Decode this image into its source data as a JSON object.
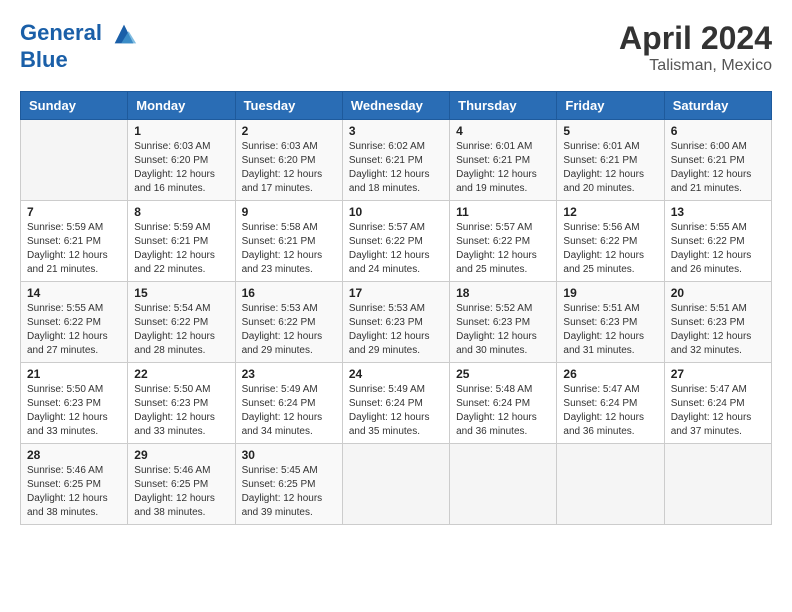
{
  "header": {
    "logo_line1": "General",
    "logo_line2": "Blue",
    "month_year": "April 2024",
    "location": "Talisman, Mexico"
  },
  "weekdays": [
    "Sunday",
    "Monday",
    "Tuesday",
    "Wednesday",
    "Thursday",
    "Friday",
    "Saturday"
  ],
  "weeks": [
    [
      {
        "day": "",
        "sunrise": "",
        "sunset": "",
        "daylight": ""
      },
      {
        "day": "1",
        "sunrise": "Sunrise: 6:03 AM",
        "sunset": "Sunset: 6:20 PM",
        "daylight": "Daylight: 12 hours and 16 minutes."
      },
      {
        "day": "2",
        "sunrise": "Sunrise: 6:03 AM",
        "sunset": "Sunset: 6:20 PM",
        "daylight": "Daylight: 12 hours and 17 minutes."
      },
      {
        "day": "3",
        "sunrise": "Sunrise: 6:02 AM",
        "sunset": "Sunset: 6:21 PM",
        "daylight": "Daylight: 12 hours and 18 minutes."
      },
      {
        "day": "4",
        "sunrise": "Sunrise: 6:01 AM",
        "sunset": "Sunset: 6:21 PM",
        "daylight": "Daylight: 12 hours and 19 minutes."
      },
      {
        "day": "5",
        "sunrise": "Sunrise: 6:01 AM",
        "sunset": "Sunset: 6:21 PM",
        "daylight": "Daylight: 12 hours and 20 minutes."
      },
      {
        "day": "6",
        "sunrise": "Sunrise: 6:00 AM",
        "sunset": "Sunset: 6:21 PM",
        "daylight": "Daylight: 12 hours and 21 minutes."
      }
    ],
    [
      {
        "day": "7",
        "sunrise": "Sunrise: 5:59 AM",
        "sunset": "Sunset: 6:21 PM",
        "daylight": "Daylight: 12 hours and 21 minutes."
      },
      {
        "day": "8",
        "sunrise": "Sunrise: 5:59 AM",
        "sunset": "Sunset: 6:21 PM",
        "daylight": "Daylight: 12 hours and 22 minutes."
      },
      {
        "day": "9",
        "sunrise": "Sunrise: 5:58 AM",
        "sunset": "Sunset: 6:21 PM",
        "daylight": "Daylight: 12 hours and 23 minutes."
      },
      {
        "day": "10",
        "sunrise": "Sunrise: 5:57 AM",
        "sunset": "Sunset: 6:22 PM",
        "daylight": "Daylight: 12 hours and 24 minutes."
      },
      {
        "day": "11",
        "sunrise": "Sunrise: 5:57 AM",
        "sunset": "Sunset: 6:22 PM",
        "daylight": "Daylight: 12 hours and 25 minutes."
      },
      {
        "day": "12",
        "sunrise": "Sunrise: 5:56 AM",
        "sunset": "Sunset: 6:22 PM",
        "daylight": "Daylight: 12 hours and 25 minutes."
      },
      {
        "day": "13",
        "sunrise": "Sunrise: 5:55 AM",
        "sunset": "Sunset: 6:22 PM",
        "daylight": "Daylight: 12 hours and 26 minutes."
      }
    ],
    [
      {
        "day": "14",
        "sunrise": "Sunrise: 5:55 AM",
        "sunset": "Sunset: 6:22 PM",
        "daylight": "Daylight: 12 hours and 27 minutes."
      },
      {
        "day": "15",
        "sunrise": "Sunrise: 5:54 AM",
        "sunset": "Sunset: 6:22 PM",
        "daylight": "Daylight: 12 hours and 28 minutes."
      },
      {
        "day": "16",
        "sunrise": "Sunrise: 5:53 AM",
        "sunset": "Sunset: 6:22 PM",
        "daylight": "Daylight: 12 hours and 29 minutes."
      },
      {
        "day": "17",
        "sunrise": "Sunrise: 5:53 AM",
        "sunset": "Sunset: 6:23 PM",
        "daylight": "Daylight: 12 hours and 29 minutes."
      },
      {
        "day": "18",
        "sunrise": "Sunrise: 5:52 AM",
        "sunset": "Sunset: 6:23 PM",
        "daylight": "Daylight: 12 hours and 30 minutes."
      },
      {
        "day": "19",
        "sunrise": "Sunrise: 5:51 AM",
        "sunset": "Sunset: 6:23 PM",
        "daylight": "Daylight: 12 hours and 31 minutes."
      },
      {
        "day": "20",
        "sunrise": "Sunrise: 5:51 AM",
        "sunset": "Sunset: 6:23 PM",
        "daylight": "Daylight: 12 hours and 32 minutes."
      }
    ],
    [
      {
        "day": "21",
        "sunrise": "Sunrise: 5:50 AM",
        "sunset": "Sunset: 6:23 PM",
        "daylight": "Daylight: 12 hours and 33 minutes."
      },
      {
        "day": "22",
        "sunrise": "Sunrise: 5:50 AM",
        "sunset": "Sunset: 6:23 PM",
        "daylight": "Daylight: 12 hours and 33 minutes."
      },
      {
        "day": "23",
        "sunrise": "Sunrise: 5:49 AM",
        "sunset": "Sunset: 6:24 PM",
        "daylight": "Daylight: 12 hours and 34 minutes."
      },
      {
        "day": "24",
        "sunrise": "Sunrise: 5:49 AM",
        "sunset": "Sunset: 6:24 PM",
        "daylight": "Daylight: 12 hours and 35 minutes."
      },
      {
        "day": "25",
        "sunrise": "Sunrise: 5:48 AM",
        "sunset": "Sunset: 6:24 PM",
        "daylight": "Daylight: 12 hours and 36 minutes."
      },
      {
        "day": "26",
        "sunrise": "Sunrise: 5:47 AM",
        "sunset": "Sunset: 6:24 PM",
        "daylight": "Daylight: 12 hours and 36 minutes."
      },
      {
        "day": "27",
        "sunrise": "Sunrise: 5:47 AM",
        "sunset": "Sunset: 6:24 PM",
        "daylight": "Daylight: 12 hours and 37 minutes."
      }
    ],
    [
      {
        "day": "28",
        "sunrise": "Sunrise: 5:46 AM",
        "sunset": "Sunset: 6:25 PM",
        "daylight": "Daylight: 12 hours and 38 minutes."
      },
      {
        "day": "29",
        "sunrise": "Sunrise: 5:46 AM",
        "sunset": "Sunset: 6:25 PM",
        "daylight": "Daylight: 12 hours and 38 minutes."
      },
      {
        "day": "30",
        "sunrise": "Sunrise: 5:45 AM",
        "sunset": "Sunset: 6:25 PM",
        "daylight": "Daylight: 12 hours and 39 minutes."
      },
      {
        "day": "",
        "sunrise": "",
        "sunset": "",
        "daylight": ""
      },
      {
        "day": "",
        "sunrise": "",
        "sunset": "",
        "daylight": ""
      },
      {
        "day": "",
        "sunrise": "",
        "sunset": "",
        "daylight": ""
      },
      {
        "day": "",
        "sunrise": "",
        "sunset": "",
        "daylight": ""
      }
    ]
  ]
}
